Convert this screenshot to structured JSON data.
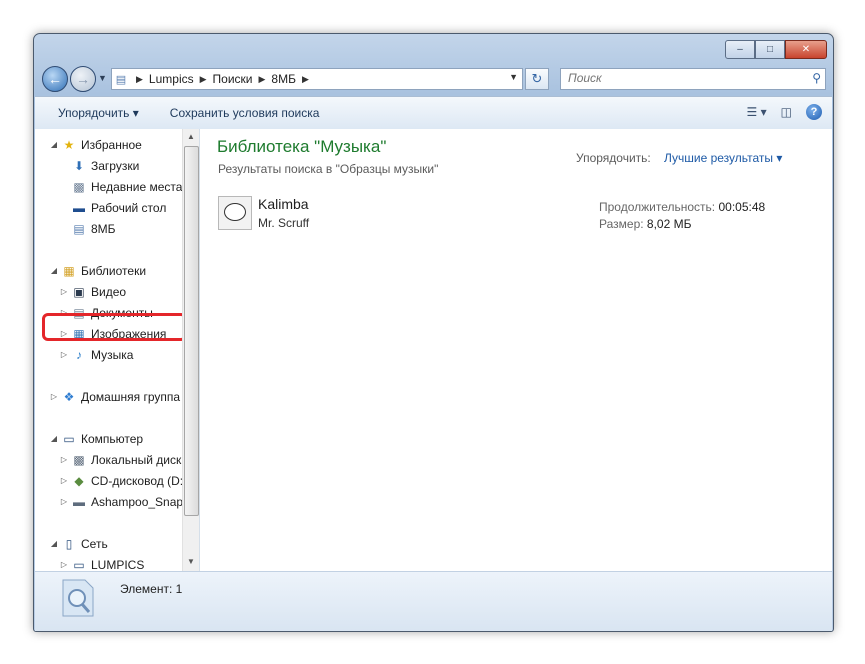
{
  "window": {
    "controls": {
      "minimize": "–",
      "maximize": "□",
      "close": "✕"
    }
  },
  "address": {
    "crumbs": [
      "Lumpics",
      "Поиски",
      "8МБ"
    ],
    "search_placeholder": "Поиск"
  },
  "toolbar": {
    "organize_label": "Упорядочить",
    "save_search_label": "Сохранить условия поиска"
  },
  "sidebar": {
    "favorites_label": "Избранное",
    "downloads_label": "Загрузки",
    "recent_label": "Недавние места",
    "desktop_label": "Рабочий стол",
    "saved_search_label": "8МБ",
    "libraries_label": "Библиотеки",
    "video_label": "Видео",
    "documents_label": "Документы",
    "pictures_label": "Изображения",
    "music_label": "Музыка",
    "homegroup_label": "Домашняя группа",
    "computer_label": "Компьютер",
    "local_disk_label": "Локальный диск",
    "cd_label": "CD-дисковод (D:",
    "ashampoo_label": "Ashampoo_Snap",
    "network_label": "Сеть",
    "lumpics_label": "LUMPICS"
  },
  "content": {
    "title": "Библиотека \"Музыка\"",
    "subtitle": "Результаты поиска в \"Образцы музыки\"",
    "sort_label": "Упорядочить:",
    "sort_value": "Лучшие результаты",
    "file": {
      "name": "Kalimba",
      "artist": "Mr. Scruff",
      "duration_label": "Продолжительность:",
      "duration_value": "00:05:48",
      "size_label": "Размер:",
      "size_value": "8,02 МБ"
    }
  },
  "status": {
    "text": "Элемент: 1"
  },
  "colors": {
    "highlight_ring": "#e4262a",
    "title_green": "#1e7b2e",
    "link_blue": "#1e5aa6"
  }
}
